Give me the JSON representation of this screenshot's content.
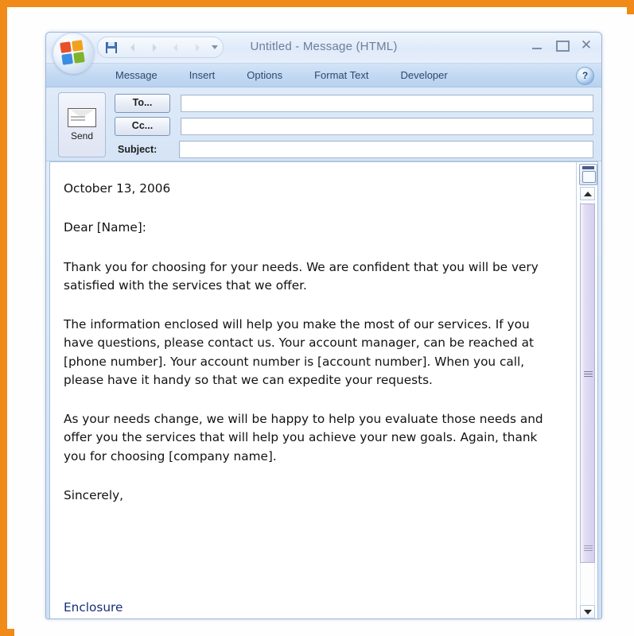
{
  "window": {
    "title": "Untitled  -  Message (HTML)",
    "office_button": "office-orb",
    "controls": {
      "minimize": "Minimize",
      "restore": "Restore",
      "close": "Close"
    }
  },
  "quick_access": {
    "items": [
      {
        "name": "save-icon",
        "label": "Save"
      },
      {
        "name": "undo-icon",
        "label": "Undo"
      },
      {
        "name": "redo-icon",
        "label": "Redo"
      },
      {
        "name": "previous-item-icon",
        "label": "Previous Item"
      },
      {
        "name": "next-item-icon",
        "label": "Next Item"
      },
      {
        "name": "customize-chevron-icon",
        "label": "Customize Quick Access Toolbar"
      }
    ]
  },
  "ribbon": {
    "tabs": [
      {
        "label": "Message",
        "active": true
      },
      {
        "label": "Insert",
        "active": false
      },
      {
        "label": "Options",
        "active": false
      },
      {
        "label": "Format Text",
        "active": false
      },
      {
        "label": "Developer",
        "active": false
      }
    ],
    "help_label": "?"
  },
  "compose": {
    "send_label": "Send",
    "to_label": "To...",
    "cc_label": "Cc...",
    "subject_label": "Subject:",
    "to_value": "",
    "cc_value": "",
    "subject_value": "",
    "to_placeholder": "",
    "cc_placeholder": "",
    "subject_placeholder": ""
  },
  "message_body": {
    "date": "October 13, 2006",
    "salutation": "Dear [Name]:",
    "paragraph_1": "Thank you for choosing for your needs. We are confident that you will be very satisfied with the services that we offer.",
    "paragraph_2": "The information enclosed will help you make the most of our services. If you have questions, please contact us. Your account manager, can be reached at [phone number]. Your account number is [account number]. When you call, please have it handy so that we can expedite your requests.",
    "paragraph_3": "As your needs change, we will be happy to help you evaluate those needs and offer you the services that will help you achieve your new goals. Again, thank you for choosing [company name].",
    "closing": "Sincerely,",
    "enclosure": "Enclosure"
  },
  "scrollbar": {
    "top_button": "show-ruler-button",
    "up_arrow": "scroll-up-arrow",
    "down_arrow": "scroll-down-arrow"
  },
  "colors": {
    "frame_orange": "#f08a18",
    "ribbon_blue": "#c3d9f3",
    "title_text": "#6b7f99",
    "enclosure_link": "#16307a",
    "scroll_thumb": "#d3cfee"
  }
}
